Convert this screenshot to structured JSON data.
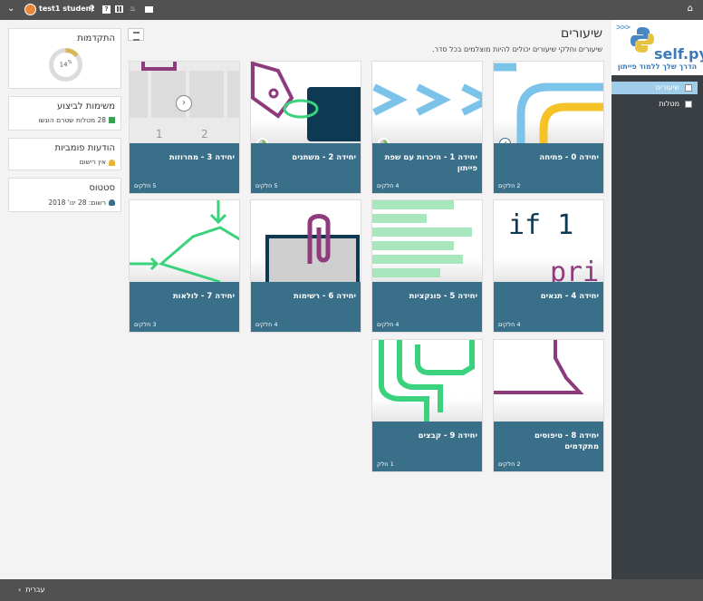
{
  "topbar": {
    "username": "test1 student",
    "menu_icon": "chevron-down-icon",
    "icons": [
      "search-icon",
      "help-icon",
      "table-icon",
      "python-icon",
      "mail-icon"
    ],
    "home_icon": "home-icon"
  },
  "sidebar": {
    "brand": "self.py",
    "logo_arrows": ">>>",
    "tagline": "הדרך שלך ללמוד פייתון",
    "items": [
      {
        "label": "שיעורים",
        "active": true
      },
      {
        "label": "מטלות",
        "active": false
      }
    ]
  },
  "main": {
    "title": "שיעורים",
    "subtitle": "שיעורים וחלקי שיעורים יכולים להיות מוצלמים בכל סדר."
  },
  "cards": [
    {
      "title": "יחידה 0 - פתיחה",
      "parts": "2 חלקים",
      "status": "done"
    },
    {
      "title": "יחידה 1 - היכרות עם שפת פייתון",
      "parts": "4 חלקים",
      "status": "progress"
    },
    {
      "title": "יחידה 2 - משתנים",
      "parts": "5 חלקים",
      "status": "progress"
    },
    {
      "title": "יחידה 3 - מחרוזות",
      "parts": "5 חלקים",
      "status": "none"
    },
    {
      "title": "יחידה 4 - תנאים",
      "parts": "4 חלקים",
      "status": "none"
    },
    {
      "title": "יחידה 5 - פונקציות",
      "parts": "4 חלקים",
      "status": "none"
    },
    {
      "title": "יחידה 6 - רשימות",
      "parts": "4 חלקים",
      "status": "none"
    },
    {
      "title": "יחידה 7 - לולאות",
      "parts": "3 חלקים",
      "status": "none"
    },
    {
      "title": "יחידה 8 - טיפוסים מתקדמים",
      "parts": "2 חלקים",
      "status": "none"
    },
    {
      "title": "יחידה 9 - קבצים",
      "parts": "1 חלק",
      "status": "none"
    }
  ],
  "card3_image": {
    "num1": "1",
    "num2": "2"
  },
  "card4_image": {
    "line1": "if 1",
    "line2": "pri"
  },
  "panels": {
    "progress": {
      "title": "התקדמות",
      "percent_label": "14",
      "percent_sup": "%",
      "value": 0.14
    },
    "tasks": {
      "title": "משימות לביצוע",
      "line": "28 מטלות שטרם הוגשו"
    },
    "announcements": {
      "title": "הודעות פומביות",
      "line": "אין רישום"
    },
    "status": {
      "title": "סטטוס",
      "line": "רשום: 28 ינו' 2018"
    }
  },
  "bottombar": {
    "language": "עברית"
  },
  "colors": {
    "topbar": "#515151",
    "sidebar": "#3a3f44",
    "card_footer": "#3a6f8a",
    "active_nav": "#9fcdea",
    "donut": "#d7b856"
  }
}
